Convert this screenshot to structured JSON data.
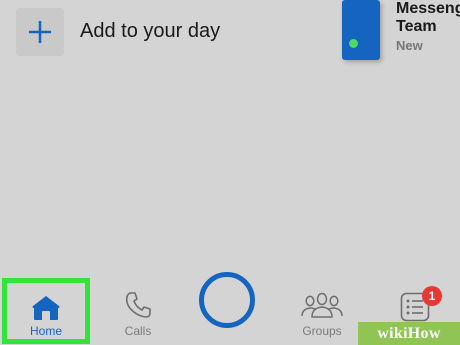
{
  "stories": {
    "add_label": "Add to your day",
    "card": {
      "name_line1": "Messeng",
      "name_line2": "Team",
      "subtitle": "New",
      "card_color": "#1565c0",
      "online_dot_color": "#4cd964"
    },
    "add_icon": "plus-icon"
  },
  "tab_bar": {
    "accent_color": "#1565c0",
    "highlight_color": "#32e33a",
    "tabs": [
      {
        "id": "home",
        "label": "Home",
        "icon": "home-icon",
        "active": true
      },
      {
        "id": "calls",
        "label": "Calls",
        "icon": "phone-icon",
        "active": false
      },
      {
        "id": "camera",
        "label": "",
        "icon": "camera-ring-icon",
        "active": false
      },
      {
        "id": "groups",
        "label": "Groups",
        "icon": "groups-icon",
        "active": false
      },
      {
        "id": "discover",
        "label": "",
        "icon": "list-icon",
        "active": false,
        "badge": "1"
      }
    ]
  },
  "watermark": {
    "text": "wikiHow"
  }
}
